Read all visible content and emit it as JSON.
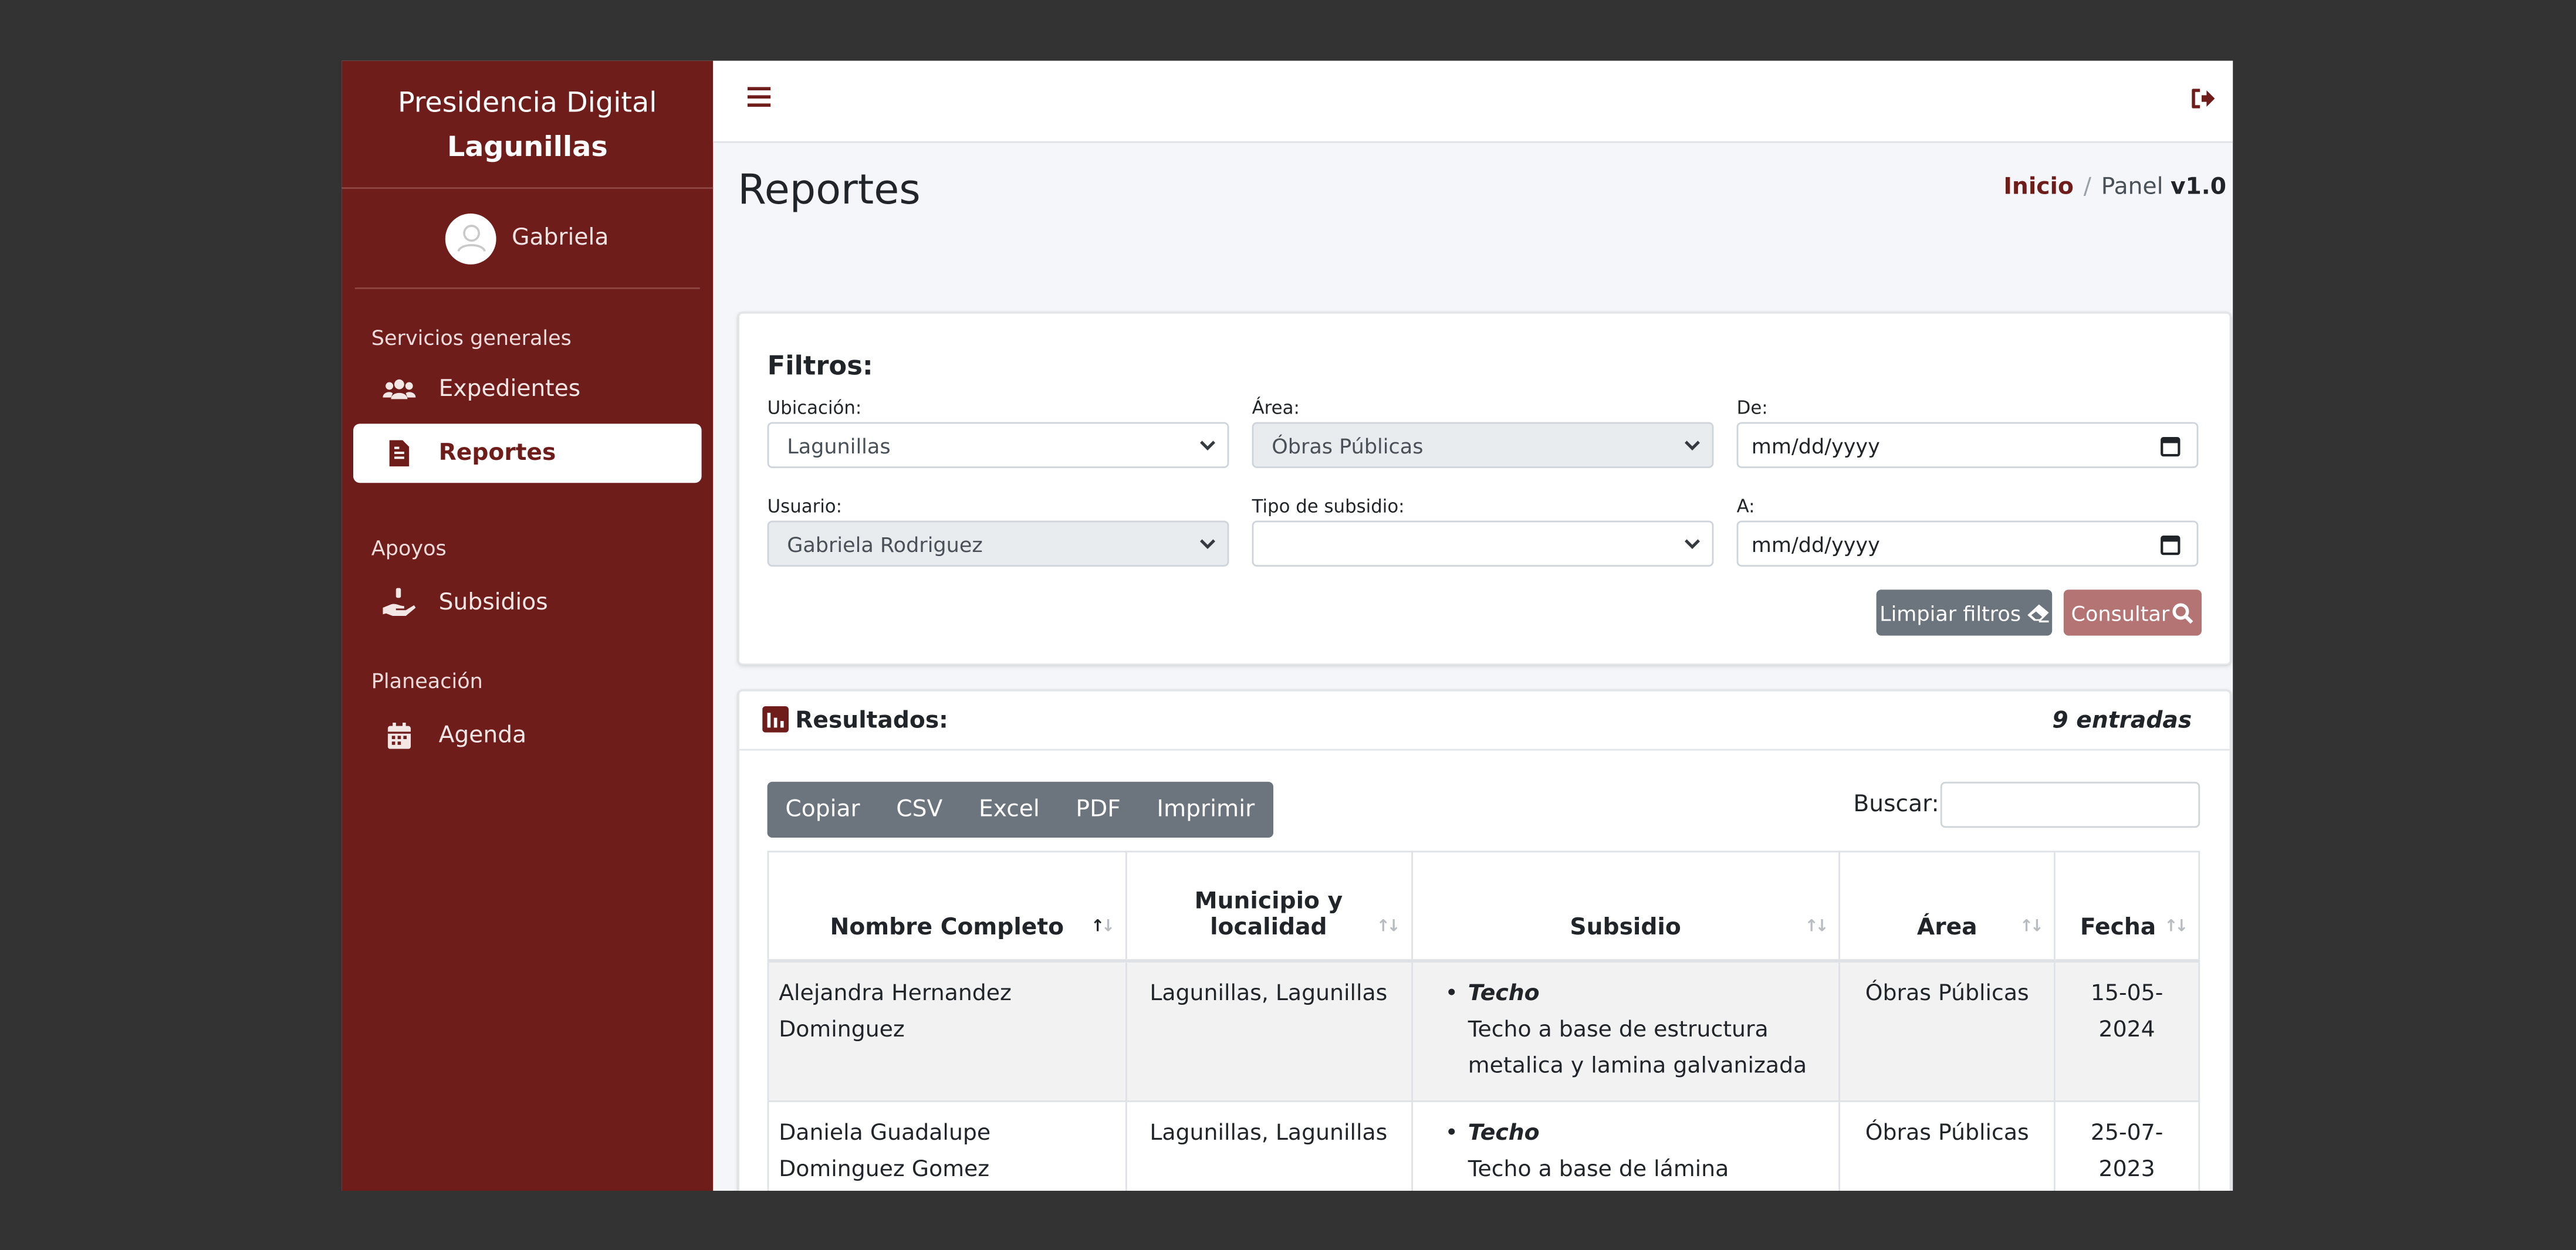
{
  "brand": {
    "line1": "Presidencia Digital",
    "line2": "Lagunillas"
  },
  "user": {
    "name": "Gabriela"
  },
  "sidebar": {
    "sections": [
      {
        "header": "Servicios generales",
        "items": [
          {
            "label": "Expedientes",
            "icon": "users-icon"
          },
          {
            "label": "Reportes",
            "icon": "report-file-icon",
            "active": true
          }
        ]
      },
      {
        "header": "Apoyos",
        "items": [
          {
            "label": "Subsidios",
            "icon": "hand-coin-icon"
          }
        ]
      },
      {
        "header": "Planeación",
        "items": [
          {
            "label": "Agenda",
            "icon": "calendar-icon"
          }
        ]
      }
    ]
  },
  "page": {
    "title": "Reportes"
  },
  "breadcrumb": {
    "home": "Inicio",
    "current": "Panel",
    "version": "v1.0"
  },
  "filters": {
    "title": "Filtros:",
    "ubicacion": {
      "label": "Ubicación:",
      "value": "Lagunillas"
    },
    "area": {
      "label": "Área:",
      "value": "Óbras Públicas"
    },
    "de": {
      "label": "De:",
      "placeholder": "mm/dd/yyyy"
    },
    "usuario": {
      "label": "Usuario:",
      "value": "Gabriela Rodriguez"
    },
    "tipo": {
      "label": "Tipo de subsidio:",
      "value": ""
    },
    "a": {
      "label": "A:",
      "placeholder": "mm/dd/yyyy"
    },
    "clear_label": "Limpiar filtros",
    "query_label": "Consultar"
  },
  "results": {
    "title": "Resultados:",
    "count": "9 entradas",
    "export_buttons": [
      "Copiar",
      "CSV",
      "Excel",
      "PDF",
      "Imprimir"
    ],
    "search_label": "Buscar:",
    "columns": [
      "Nombre Completo",
      "Municipio y localidad",
      "Subsidio",
      "Área",
      "Fecha"
    ],
    "rows": [
      {
        "nombre": "Alejandra Hernandez Dominguez",
        "municipio": "Lagunillas, Lagunillas",
        "subsidio_nombre": "Techo",
        "subsidio_desc": "Techo a base de estructura metalica y lamina galvanizada",
        "area": "Óbras Públicas",
        "fecha": "15-05-2024"
      },
      {
        "nombre": "Daniela Guadalupe Dominguez Gomez",
        "municipio": "Lagunillas, Lagunillas",
        "subsidio_nombre": "Techo",
        "subsidio_desc": "Techo a base de lámina galvanizada y estructura metálica.",
        "area": "Óbras Públicas",
        "fecha": "25-07-2023"
      }
    ]
  },
  "colors": {
    "brand": "#6f1d1b",
    "backdrop": "#333333",
    "secondary": "#6c757d",
    "query_button": "#b47474"
  }
}
